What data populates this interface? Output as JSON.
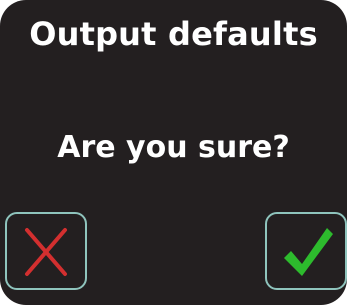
{
  "dialog": {
    "title": "Output defaults",
    "question": "Are you sure?"
  },
  "buttons": {
    "cancel": {
      "icon": "cross-icon",
      "color": "#d32f2f"
    },
    "confirm": {
      "icon": "checkmark-icon",
      "color": "#2dbb2d"
    }
  },
  "colors": {
    "background": "#231f20",
    "text": "#ffffff",
    "button_border": "#8fc4bd"
  }
}
